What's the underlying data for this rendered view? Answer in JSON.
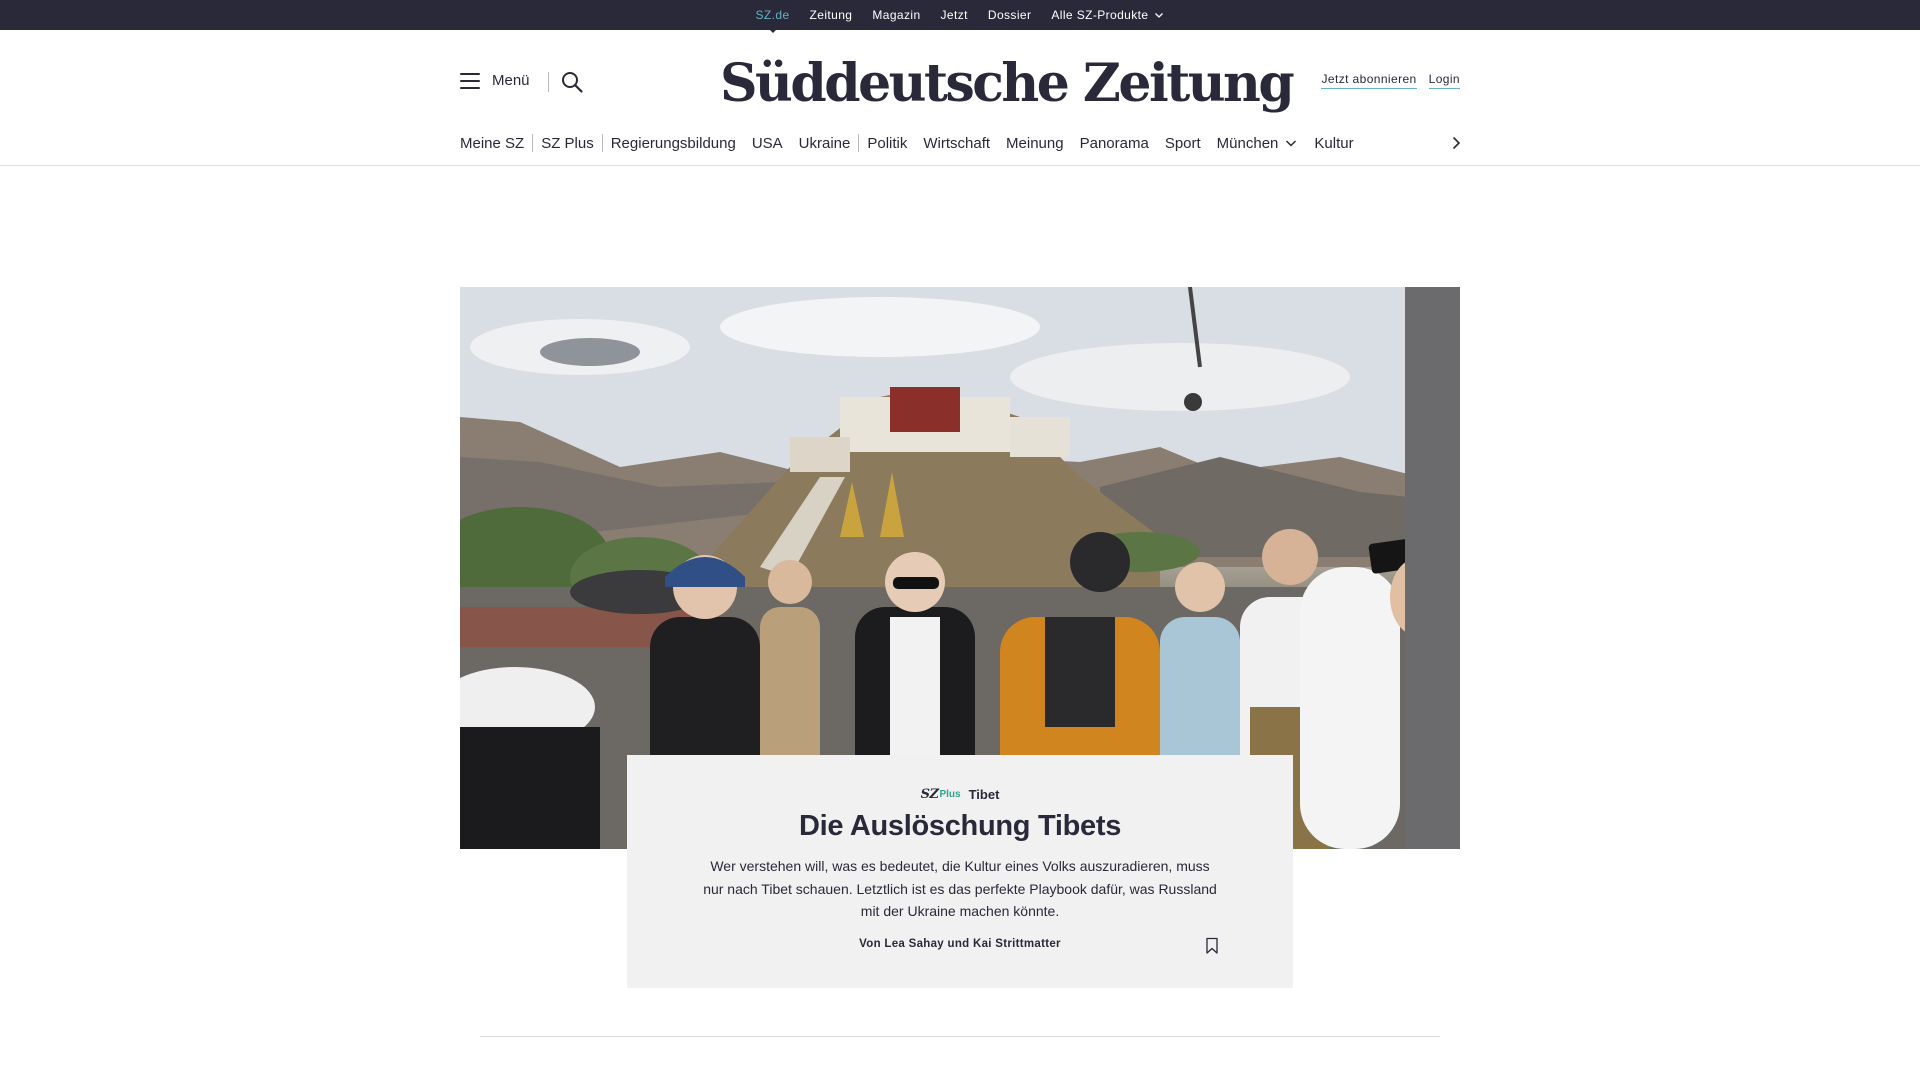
{
  "topbar": {
    "items": [
      {
        "label": "SZ.de"
      },
      {
        "label": "Zeitung"
      },
      {
        "label": "Magazin"
      },
      {
        "label": "Jetzt"
      },
      {
        "label": "Dossier"
      },
      {
        "label": "Alle SZ-Produkte"
      }
    ],
    "active": "SZ.de"
  },
  "header": {
    "menu_label": "Menü",
    "logo_text": "Süddeutsche Zeitung",
    "subscribe_label": "Jetzt abonnieren",
    "login_label": "Login"
  },
  "sections": [
    {
      "label": "Meine SZ"
    },
    {
      "label": "SZ Plus"
    },
    {
      "label": "Regierungsbildung"
    },
    {
      "label": "USA"
    },
    {
      "label": "Ukraine"
    },
    {
      "label": "Politik"
    },
    {
      "label": "Wirtschaft"
    },
    {
      "label": "Meinung"
    },
    {
      "label": "Panorama"
    },
    {
      "label": "Sport"
    },
    {
      "label": "München"
    },
    {
      "label": "Kultur"
    }
  ],
  "teaser": {
    "brand": "SZ",
    "brand_plus": "Plus",
    "topic": "Tibet",
    "headline": "Die Auslöschung Tibets",
    "lead": "Wer verstehen will, was es bedeutet, die Kultur eines Volks auszuradieren, muss nur nach Tibet schauen. Letztlich ist es das perfekte Playbook dafür, was Russland mit der Ukraine machen könnte.",
    "byline": "Von Lea Sahay und Kai Strittmatter"
  },
  "colors": {
    "brand_dark": "#29293a",
    "active_link": "#65b3c4",
    "plus_green": "#2ca58d",
    "card_bg": "#f1f1f1"
  },
  "icons": [
    "hamburger-icon",
    "search-icon",
    "chevron-down-icon",
    "chevron-right-icon",
    "bookmark-icon"
  ]
}
